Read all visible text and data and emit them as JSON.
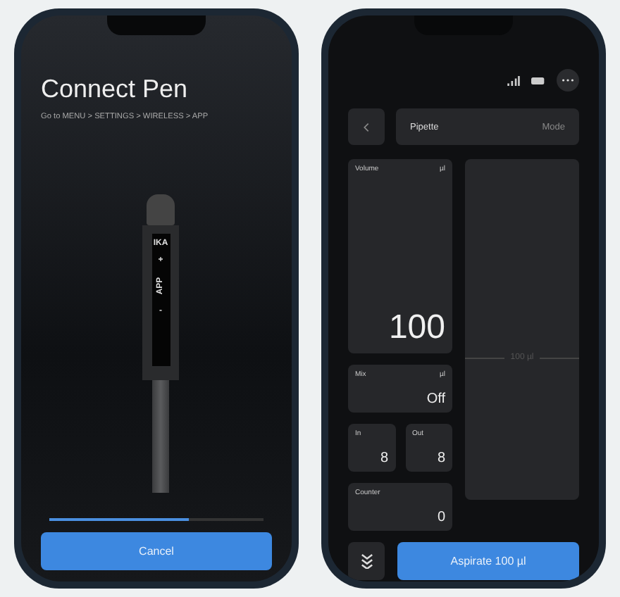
{
  "connect_screen": {
    "title": "Connect Pen",
    "instruction": "Go to MENU > SETTINGS > WIRELESS > APP",
    "pen_labels": [
      {
        "text": "IKA",
        "kind": "brand"
      },
      {
        "text": "+",
        "kind": "key"
      },
      {
        "text": "APP",
        "kind": "vertical"
      },
      {
        "text": "-",
        "kind": "key"
      }
    ],
    "progress": {
      "level": 0.65
    },
    "button": "Cancel"
  },
  "pipette_screen": {
    "mode_bar": {
      "name": "Pipette",
      "action": "Mode"
    },
    "volume": {
      "label": "Volume",
      "unit": "µl",
      "value": "100"
    },
    "gauge_label": "100 µl",
    "mix": {
      "label": "Mix",
      "unit": "µl",
      "value": "Off"
    },
    "in": {
      "label": "In",
      "value": "8"
    },
    "out": {
      "label": "Out",
      "value": "8"
    },
    "counter": {
      "label": "Counter",
      "value": "0"
    },
    "button": "Aspirate 100 µl"
  }
}
